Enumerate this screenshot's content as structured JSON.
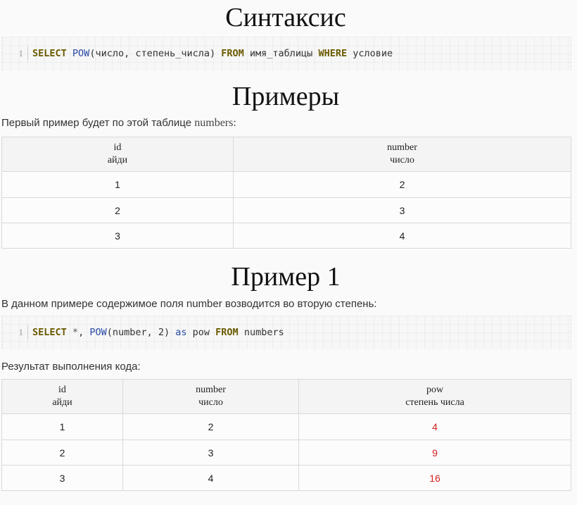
{
  "syntax": {
    "heading": "Синтаксис",
    "line_no": "1",
    "tokens": [
      {
        "t": "kw",
        "v": "SELECT"
      },
      {
        "t": "plain",
        "v": " "
      },
      {
        "t": "fn",
        "v": "POW"
      },
      {
        "t": "plain",
        "v": "(число, степень_числа) "
      },
      {
        "t": "kw",
        "v": "FROM"
      },
      {
        "t": "plain",
        "v": " имя_таблицы "
      },
      {
        "t": "kw",
        "v": "WHERE"
      },
      {
        "t": "plain",
        "v": " условие"
      }
    ]
  },
  "examples": {
    "heading": "Примеры",
    "intro_text": "Первый пример будет по этой таблице ",
    "intro_table": "numbers:",
    "table": {
      "headers": [
        {
          "name": "id",
          "sub": "айди"
        },
        {
          "name": "number",
          "sub": "число"
        }
      ],
      "rows": [
        [
          "1",
          "2"
        ],
        [
          "2",
          "3"
        ],
        [
          "3",
          "4"
        ]
      ]
    }
  },
  "example1": {
    "heading": "Пример 1",
    "description": "В данном примере содержимое поля number возводится во вторую степень:",
    "line_no": "1",
    "tokens": [
      {
        "t": "kw",
        "v": "SELECT"
      },
      {
        "t": "plain",
        "v": " "
      },
      {
        "t": "op",
        "v": "*"
      },
      {
        "t": "plain",
        "v": ", "
      },
      {
        "t": "fn",
        "v": "POW"
      },
      {
        "t": "plain",
        "v": "(number, 2) "
      },
      {
        "t": "lower-kw",
        "v": "as"
      },
      {
        "t": "plain",
        "v": " pow "
      },
      {
        "t": "kw",
        "v": "FROM"
      },
      {
        "t": "plain",
        "v": " numbers"
      }
    ],
    "result_label": "Результат выполнения кода:",
    "table": {
      "headers": [
        {
          "name": "id",
          "sub": "айди"
        },
        {
          "name": "number",
          "sub": "число"
        },
        {
          "name": "pow",
          "sub": "степень числа"
        }
      ],
      "rows": [
        [
          "1",
          "2",
          "4"
        ],
        [
          "2",
          "3",
          "9"
        ],
        [
          "3",
          "4",
          "16"
        ]
      ]
    },
    "highlight_color": "#d42020"
  }
}
